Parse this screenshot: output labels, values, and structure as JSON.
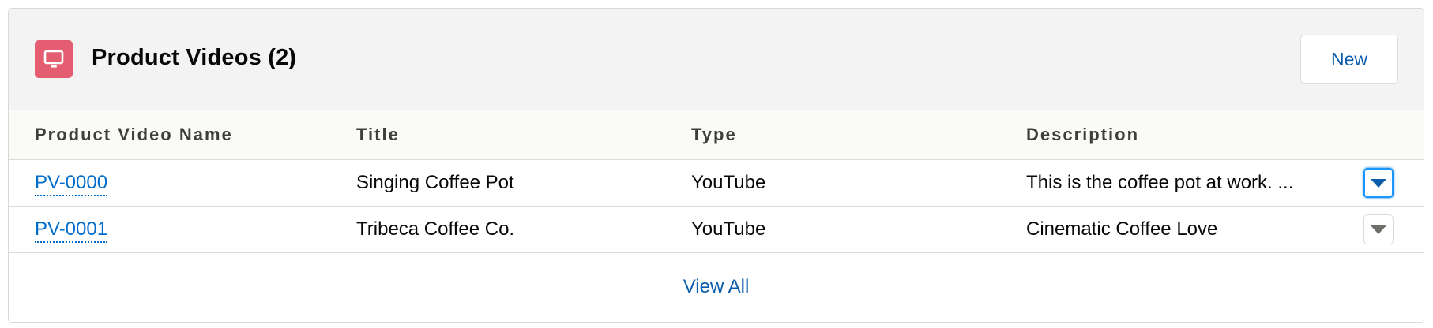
{
  "header": {
    "title": "Product Videos (2)",
    "icon": "monitor-icon",
    "icon_color": "#e45d70",
    "new_label": "New"
  },
  "table": {
    "columns": [
      "Product Video Name",
      "Title",
      "Type",
      "Description"
    ],
    "rows": [
      {
        "name": "PV-0000",
        "title": "Singing Coffee Pot",
        "type": "YouTube",
        "description": "This is the coffee pot at work. ..."
      },
      {
        "name": "PV-0001",
        "title": "Tribeca Coffee Co.",
        "type": "YouTube",
        "description": "Cinematic Coffee Love"
      }
    ]
  },
  "footer": {
    "view_all_label": "View All"
  },
  "colors": {
    "link": "#006dcc",
    "header_bg": "#f3f3f3",
    "focus_ring": "#1b96ff"
  }
}
